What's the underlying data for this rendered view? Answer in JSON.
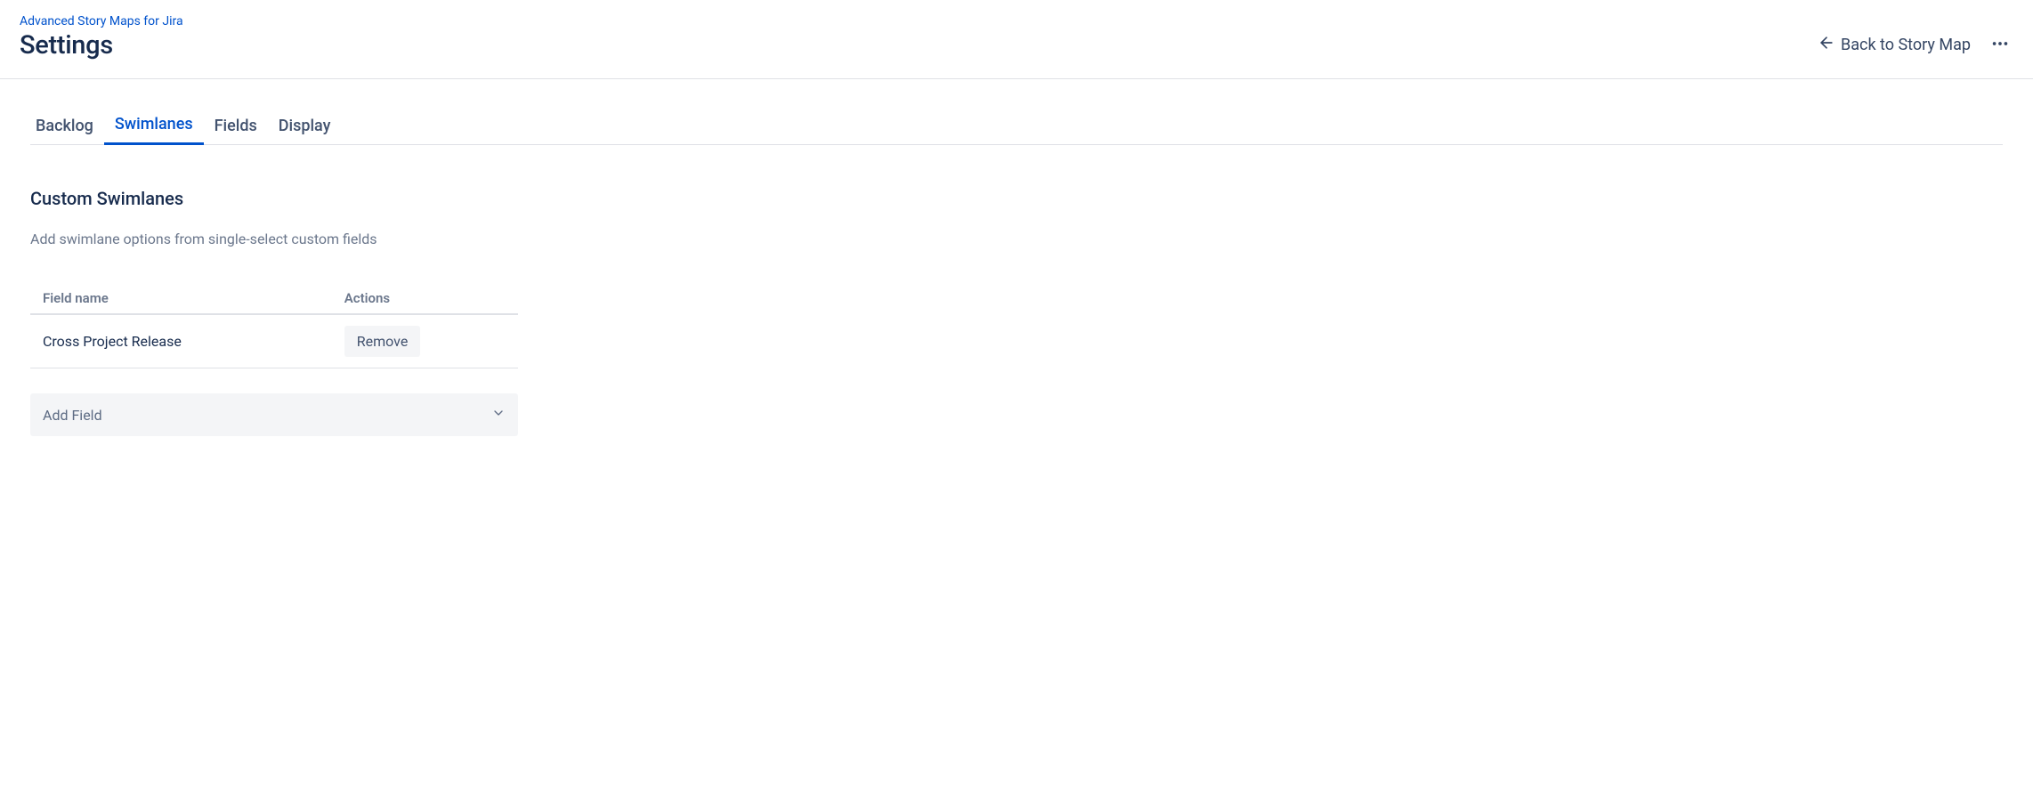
{
  "breadcrumb": "Advanced Story Maps for Jira",
  "page_title": "Settings",
  "header": {
    "back_label": "Back to Story Map"
  },
  "tabs": [
    {
      "label": "Backlog",
      "active": false
    },
    {
      "label": "Swimlanes",
      "active": true
    },
    {
      "label": "Fields",
      "active": false
    },
    {
      "label": "Display",
      "active": false
    }
  ],
  "section": {
    "title": "Custom Swimlanes",
    "description": "Add swimlane options from single-select custom fields"
  },
  "table": {
    "headers": {
      "field_name": "Field name",
      "actions": "Actions"
    },
    "rows": [
      {
        "field_name": "Cross Project Release",
        "action_label": "Remove"
      }
    ]
  },
  "add_field_placeholder": "Add Field"
}
